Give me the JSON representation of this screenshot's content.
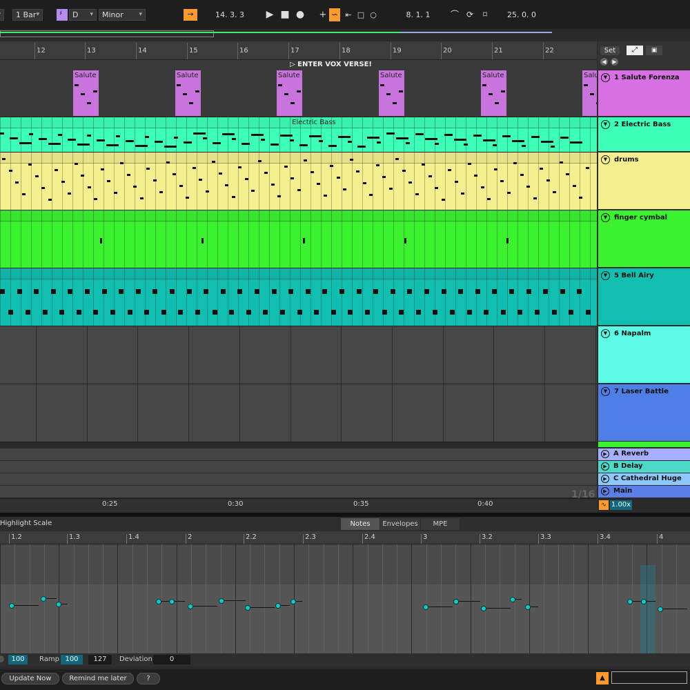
{
  "transport": {
    "quantize": "1 Bar",
    "key": "D",
    "scale": "Minor",
    "position": "14.  3.  3",
    "loop_start": "8.  1.  1",
    "loop_length": "25.  0.  0"
  },
  "ruler": {
    "bars": [
      "12",
      "13",
      "14",
      "15",
      "16",
      "17",
      "18",
      "19",
      "20",
      "21",
      "22"
    ]
  },
  "locator": "ENTER VOX VERSE!",
  "side_buttons": {
    "set": "Set"
  },
  "tracks": [
    {
      "name": "1 Salute Forenza",
      "color": "#d670e3",
      "clip_color": "#c874dc",
      "clip_label": "Salute F"
    },
    {
      "name": "2 Electric Bass",
      "color": "#3dffb8",
      "clip_label": "Electric Bass"
    },
    {
      "name": "drums",
      "color": "#f5ef8f"
    },
    {
      "name": "finger cymbal",
      "color": "#3cf230"
    },
    {
      "name": "5 Bell Airy",
      "color": "#11bfb1"
    },
    {
      "name": "6 Napalm",
      "color": "#5dfbe6"
    },
    {
      "name": "7 Laser Battle",
      "color": "#4f7fe6"
    }
  ],
  "returns": [
    {
      "name": "A Reverb",
      "color": "#a7b0ff"
    },
    {
      "name": "B Delay",
      "color": "#4dd9c8"
    },
    {
      "name": "C Cathedral Huge",
      "color": "#8fc8ff"
    },
    {
      "name": "Main",
      "color": "#5b7fe6"
    }
  ],
  "time_labels": [
    "0:25",
    "0:30",
    "0:35",
    "0:40"
  ],
  "grid_label": "1/16",
  "tempo_scale": "1.00x",
  "clip_view": {
    "highlight_scale": "Highlight Scale",
    "tabs": [
      "Notes",
      "Envelopes",
      "MPE"
    ],
    "active_tab": "Notes",
    "beats": [
      "1.2",
      "1.3",
      "1.4",
      "2",
      "2.2",
      "2.3",
      "2.4",
      "3",
      "3.2",
      "3.3",
      "3.4",
      "4"
    ]
  },
  "velocity": {
    "value": "100",
    "ramp_label": "Ramp",
    "ramp_from": "100",
    "ramp_to": "127",
    "deviation_label": "Deviation",
    "deviation": "0"
  },
  "status": {
    "update_now": "Update Now",
    "remind_later": "Remind me later",
    "help": "?"
  }
}
